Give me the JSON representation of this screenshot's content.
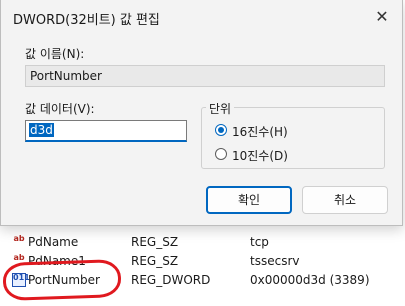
{
  "dialog": {
    "title": "DWORD(32비트) 값 편집",
    "close_glyph": "✕",
    "value_name_label": "값 이름(N):",
    "value_name": "PortNumber",
    "value_data_label": "값 데이터(V):",
    "value_data": "d3d",
    "base_group_label": "단위",
    "base_hex_label": "16진수(H)",
    "base_dec_label": "10진수(D)",
    "ok_label": "확인",
    "cancel_label": "취소"
  },
  "registry_rows": [
    {
      "name": "PdName",
      "type": "REG_SZ",
      "data": "tcp",
      "icon": "string-value-icon"
    },
    {
      "name": "PdName1",
      "type": "REG_SZ",
      "data": "tssecsrv",
      "icon": "string-value-icon"
    },
    {
      "name": "PortNumber",
      "type": "REG_DWORD",
      "data": "0x00000d3d (3389)",
      "icon": "binary-value-icon"
    }
  ],
  "icons": {
    "string": "ab",
    "binary": "011"
  },
  "colors": {
    "accent": "#0067c0",
    "annotation": "#e0191f"
  }
}
